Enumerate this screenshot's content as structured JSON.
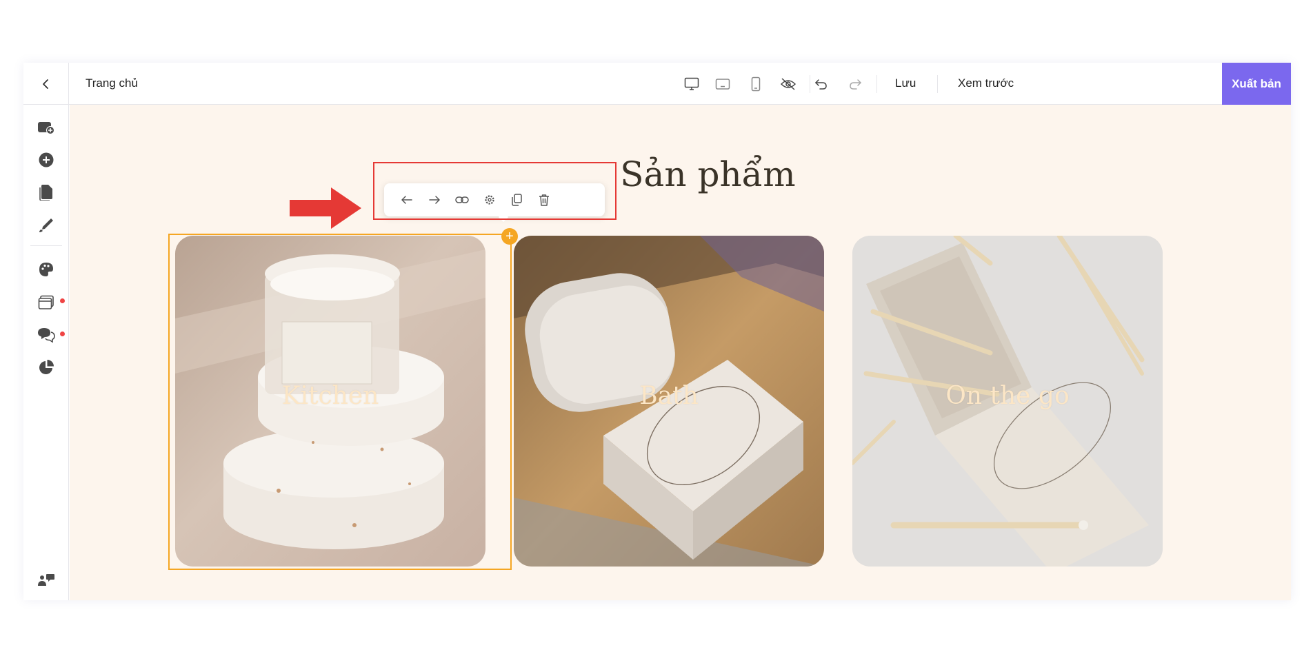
{
  "topbar": {
    "page_name": "Trang chủ",
    "save_label": "Lưu",
    "preview_label": "Xem trước",
    "publish_label": "Xuất bản",
    "accent_color": "#7b68ee"
  },
  "sidebar": {
    "items": [
      {
        "icon": "add-page-icon"
      },
      {
        "icon": "plus-circle-icon"
      },
      {
        "icon": "pages-icon"
      },
      {
        "icon": "brush-icon"
      },
      {
        "icon": "palette-icon"
      },
      {
        "icon": "layers-icon",
        "badge": true
      },
      {
        "icon": "chat-icon",
        "badge": true
      },
      {
        "icon": "pie-chart-icon"
      },
      {
        "icon": "community-icon"
      }
    ],
    "badge_color": "#ef4444"
  },
  "canvas": {
    "background": "#fdf5ed",
    "section_title": "Sản phẩm",
    "cards": [
      {
        "label": "Kitchen"
      },
      {
        "label": "Bath"
      },
      {
        "label": "On the go"
      }
    ],
    "selection_color": "#f5a623"
  },
  "element_toolbar": {
    "tools": [
      "arrow-left-icon",
      "arrow-right-icon",
      "link-icon",
      "settings-icon",
      "duplicate-icon",
      "trash-icon"
    ]
  },
  "annotation": {
    "color": "#e53935"
  }
}
